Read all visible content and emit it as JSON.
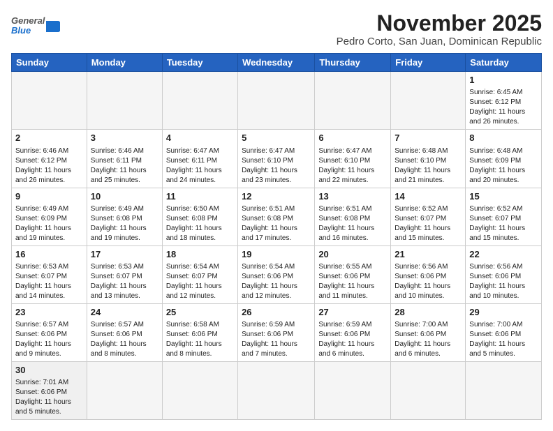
{
  "header": {
    "logo_general": "General",
    "logo_blue": "Blue",
    "title": "November 2025",
    "subtitle": "Pedro Corto, San Juan, Dominican Republic"
  },
  "weekdays": [
    "Sunday",
    "Monday",
    "Tuesday",
    "Wednesday",
    "Thursday",
    "Friday",
    "Saturday"
  ],
  "weeks": [
    [
      {
        "day": "",
        "info": ""
      },
      {
        "day": "",
        "info": ""
      },
      {
        "day": "",
        "info": ""
      },
      {
        "day": "",
        "info": ""
      },
      {
        "day": "",
        "info": ""
      },
      {
        "day": "",
        "info": ""
      },
      {
        "day": "1",
        "info": "Sunrise: 6:45 AM\nSunset: 6:12 PM\nDaylight: 11 hours\nand 26 minutes."
      }
    ],
    [
      {
        "day": "2",
        "info": "Sunrise: 6:46 AM\nSunset: 6:12 PM\nDaylight: 11 hours\nand 26 minutes."
      },
      {
        "day": "3",
        "info": "Sunrise: 6:46 AM\nSunset: 6:11 PM\nDaylight: 11 hours\nand 25 minutes."
      },
      {
        "day": "4",
        "info": "Sunrise: 6:47 AM\nSunset: 6:11 PM\nDaylight: 11 hours\nand 24 minutes."
      },
      {
        "day": "5",
        "info": "Sunrise: 6:47 AM\nSunset: 6:10 PM\nDaylight: 11 hours\nand 23 minutes."
      },
      {
        "day": "6",
        "info": "Sunrise: 6:47 AM\nSunset: 6:10 PM\nDaylight: 11 hours\nand 22 minutes."
      },
      {
        "day": "7",
        "info": "Sunrise: 6:48 AM\nSunset: 6:10 PM\nDaylight: 11 hours\nand 21 minutes."
      },
      {
        "day": "8",
        "info": "Sunrise: 6:48 AM\nSunset: 6:09 PM\nDaylight: 11 hours\nand 20 minutes."
      }
    ],
    [
      {
        "day": "9",
        "info": "Sunrise: 6:49 AM\nSunset: 6:09 PM\nDaylight: 11 hours\nand 19 minutes."
      },
      {
        "day": "10",
        "info": "Sunrise: 6:49 AM\nSunset: 6:08 PM\nDaylight: 11 hours\nand 19 minutes."
      },
      {
        "day": "11",
        "info": "Sunrise: 6:50 AM\nSunset: 6:08 PM\nDaylight: 11 hours\nand 18 minutes."
      },
      {
        "day": "12",
        "info": "Sunrise: 6:51 AM\nSunset: 6:08 PM\nDaylight: 11 hours\nand 17 minutes."
      },
      {
        "day": "13",
        "info": "Sunrise: 6:51 AM\nSunset: 6:08 PM\nDaylight: 11 hours\nand 16 minutes."
      },
      {
        "day": "14",
        "info": "Sunrise: 6:52 AM\nSunset: 6:07 PM\nDaylight: 11 hours\nand 15 minutes."
      },
      {
        "day": "15",
        "info": "Sunrise: 6:52 AM\nSunset: 6:07 PM\nDaylight: 11 hours\nand 15 minutes."
      }
    ],
    [
      {
        "day": "16",
        "info": "Sunrise: 6:53 AM\nSunset: 6:07 PM\nDaylight: 11 hours\nand 14 minutes."
      },
      {
        "day": "17",
        "info": "Sunrise: 6:53 AM\nSunset: 6:07 PM\nDaylight: 11 hours\nand 13 minutes."
      },
      {
        "day": "18",
        "info": "Sunrise: 6:54 AM\nSunset: 6:07 PM\nDaylight: 11 hours\nand 12 minutes."
      },
      {
        "day": "19",
        "info": "Sunrise: 6:54 AM\nSunset: 6:06 PM\nDaylight: 11 hours\nand 12 minutes."
      },
      {
        "day": "20",
        "info": "Sunrise: 6:55 AM\nSunset: 6:06 PM\nDaylight: 11 hours\nand 11 minutes."
      },
      {
        "day": "21",
        "info": "Sunrise: 6:56 AM\nSunset: 6:06 PM\nDaylight: 11 hours\nand 10 minutes."
      },
      {
        "day": "22",
        "info": "Sunrise: 6:56 AM\nSunset: 6:06 PM\nDaylight: 11 hours\nand 10 minutes."
      }
    ],
    [
      {
        "day": "23",
        "info": "Sunrise: 6:57 AM\nSunset: 6:06 PM\nDaylight: 11 hours\nand 9 minutes."
      },
      {
        "day": "24",
        "info": "Sunrise: 6:57 AM\nSunset: 6:06 PM\nDaylight: 11 hours\nand 8 minutes."
      },
      {
        "day": "25",
        "info": "Sunrise: 6:58 AM\nSunset: 6:06 PM\nDaylight: 11 hours\nand 8 minutes."
      },
      {
        "day": "26",
        "info": "Sunrise: 6:59 AM\nSunset: 6:06 PM\nDaylight: 11 hours\nand 7 minutes."
      },
      {
        "day": "27",
        "info": "Sunrise: 6:59 AM\nSunset: 6:06 PM\nDaylight: 11 hours\nand 6 minutes."
      },
      {
        "day": "28",
        "info": "Sunrise: 7:00 AM\nSunset: 6:06 PM\nDaylight: 11 hours\nand 6 minutes."
      },
      {
        "day": "29",
        "info": "Sunrise: 7:00 AM\nSunset: 6:06 PM\nDaylight: 11 hours\nand 5 minutes."
      }
    ],
    [
      {
        "day": "30",
        "info": "Sunrise: 7:01 AM\nSunset: 6:06 PM\nDaylight: 11 hours\nand 5 minutes."
      },
      {
        "day": "",
        "info": ""
      },
      {
        "day": "",
        "info": ""
      },
      {
        "day": "",
        "info": ""
      },
      {
        "day": "",
        "info": ""
      },
      {
        "day": "",
        "info": ""
      },
      {
        "day": "",
        "info": ""
      }
    ]
  ]
}
